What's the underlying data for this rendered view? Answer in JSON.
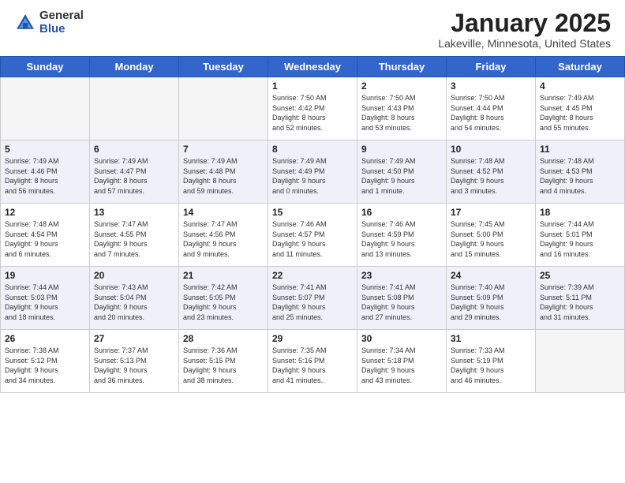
{
  "header": {
    "logo_general": "General",
    "logo_blue": "Blue",
    "title": "January 2025",
    "location": "Lakeville, Minnesota, United States"
  },
  "days_of_week": [
    "Sunday",
    "Monday",
    "Tuesday",
    "Wednesday",
    "Thursday",
    "Friday",
    "Saturday"
  ],
  "weeks": [
    [
      {
        "day": "",
        "info": ""
      },
      {
        "day": "",
        "info": ""
      },
      {
        "day": "",
        "info": ""
      },
      {
        "day": "1",
        "info": "Sunrise: 7:50 AM\nSunset: 4:42 PM\nDaylight: 8 hours\nand 52 minutes."
      },
      {
        "day": "2",
        "info": "Sunrise: 7:50 AM\nSunset: 4:43 PM\nDaylight: 8 hours\nand 53 minutes."
      },
      {
        "day": "3",
        "info": "Sunrise: 7:50 AM\nSunset: 4:44 PM\nDaylight: 8 hours\nand 54 minutes."
      },
      {
        "day": "4",
        "info": "Sunrise: 7:49 AM\nSunset: 4:45 PM\nDaylight: 8 hours\nand 55 minutes."
      }
    ],
    [
      {
        "day": "5",
        "info": "Sunrise: 7:49 AM\nSunset: 4:46 PM\nDaylight: 8 hours\nand 56 minutes."
      },
      {
        "day": "6",
        "info": "Sunrise: 7:49 AM\nSunset: 4:47 PM\nDaylight: 8 hours\nand 57 minutes."
      },
      {
        "day": "7",
        "info": "Sunrise: 7:49 AM\nSunset: 4:48 PM\nDaylight: 8 hours\nand 59 minutes."
      },
      {
        "day": "8",
        "info": "Sunrise: 7:49 AM\nSunset: 4:49 PM\nDaylight: 9 hours\nand 0 minutes."
      },
      {
        "day": "9",
        "info": "Sunrise: 7:49 AM\nSunset: 4:50 PM\nDaylight: 9 hours\nand 1 minute."
      },
      {
        "day": "10",
        "info": "Sunrise: 7:48 AM\nSunset: 4:52 PM\nDaylight: 9 hours\nand 3 minutes."
      },
      {
        "day": "11",
        "info": "Sunrise: 7:48 AM\nSunset: 4:53 PM\nDaylight: 9 hours\nand 4 minutes."
      }
    ],
    [
      {
        "day": "12",
        "info": "Sunrise: 7:48 AM\nSunset: 4:54 PM\nDaylight: 9 hours\nand 6 minutes."
      },
      {
        "day": "13",
        "info": "Sunrise: 7:47 AM\nSunset: 4:55 PM\nDaylight: 9 hours\nand 7 minutes."
      },
      {
        "day": "14",
        "info": "Sunrise: 7:47 AM\nSunset: 4:56 PM\nDaylight: 9 hours\nand 9 minutes."
      },
      {
        "day": "15",
        "info": "Sunrise: 7:46 AM\nSunset: 4:57 PM\nDaylight: 9 hours\nand 11 minutes."
      },
      {
        "day": "16",
        "info": "Sunrise: 7:46 AM\nSunset: 4:59 PM\nDaylight: 9 hours\nand 13 minutes."
      },
      {
        "day": "17",
        "info": "Sunrise: 7:45 AM\nSunset: 5:00 PM\nDaylight: 9 hours\nand 15 minutes."
      },
      {
        "day": "18",
        "info": "Sunrise: 7:44 AM\nSunset: 5:01 PM\nDaylight: 9 hours\nand 16 minutes."
      }
    ],
    [
      {
        "day": "19",
        "info": "Sunrise: 7:44 AM\nSunset: 5:03 PM\nDaylight: 9 hours\nand 18 minutes."
      },
      {
        "day": "20",
        "info": "Sunrise: 7:43 AM\nSunset: 5:04 PM\nDaylight: 9 hours\nand 20 minutes."
      },
      {
        "day": "21",
        "info": "Sunrise: 7:42 AM\nSunset: 5:05 PM\nDaylight: 9 hours\nand 23 minutes."
      },
      {
        "day": "22",
        "info": "Sunrise: 7:41 AM\nSunset: 5:07 PM\nDaylight: 9 hours\nand 25 minutes."
      },
      {
        "day": "23",
        "info": "Sunrise: 7:41 AM\nSunset: 5:08 PM\nDaylight: 9 hours\nand 27 minutes."
      },
      {
        "day": "24",
        "info": "Sunrise: 7:40 AM\nSunset: 5:09 PM\nDaylight: 9 hours\nand 29 minutes."
      },
      {
        "day": "25",
        "info": "Sunrise: 7:39 AM\nSunset: 5:11 PM\nDaylight: 9 hours\nand 31 minutes."
      }
    ],
    [
      {
        "day": "26",
        "info": "Sunrise: 7:38 AM\nSunset: 5:12 PM\nDaylight: 9 hours\nand 34 minutes."
      },
      {
        "day": "27",
        "info": "Sunrise: 7:37 AM\nSunset: 5:13 PM\nDaylight: 9 hours\nand 36 minutes."
      },
      {
        "day": "28",
        "info": "Sunrise: 7:36 AM\nSunset: 5:15 PM\nDaylight: 9 hours\nand 38 minutes."
      },
      {
        "day": "29",
        "info": "Sunrise: 7:35 AM\nSunset: 5:16 PM\nDaylight: 9 hours\nand 41 minutes."
      },
      {
        "day": "30",
        "info": "Sunrise: 7:34 AM\nSunset: 5:18 PM\nDaylight: 9 hours\nand 43 minutes."
      },
      {
        "day": "31",
        "info": "Sunrise: 7:33 AM\nSunset: 5:19 PM\nDaylight: 9 hours\nand 46 minutes."
      },
      {
        "day": "",
        "info": ""
      }
    ]
  ]
}
